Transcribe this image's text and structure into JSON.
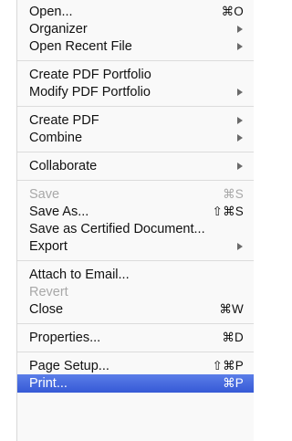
{
  "menu": {
    "items": [
      {
        "label": "Open...",
        "shortcut": "⌘O"
      },
      {
        "label": "Organizer"
      },
      {
        "label": "Open Recent File"
      },
      {
        "label": "Create PDF Portfolio"
      },
      {
        "label": "Modify PDF Portfolio"
      },
      {
        "label": "Create PDF"
      },
      {
        "label": "Combine"
      },
      {
        "label": "Collaborate"
      },
      {
        "label": "Save",
        "shortcut": "⌘S"
      },
      {
        "label": "Save As...",
        "shortcut": "⇧⌘S"
      },
      {
        "label": "Save as Certified Document..."
      },
      {
        "label": "Export"
      },
      {
        "label": "Attach to Email..."
      },
      {
        "label": "Revert"
      },
      {
        "label": "Close",
        "shortcut": "⌘W"
      },
      {
        "label": "Properties...",
        "shortcut": "⌘D"
      },
      {
        "label": "Page Setup...",
        "shortcut": "⇧⌘P"
      },
      {
        "label": "Print...",
        "shortcut": "⌘P"
      }
    ]
  },
  "icons": {
    "submenu_arrow": "chevron-right-icon"
  },
  "colors": {
    "highlight": "#3d63dc",
    "disabled_text": "#a8a8a8",
    "separator": "#dcdcdc"
  }
}
